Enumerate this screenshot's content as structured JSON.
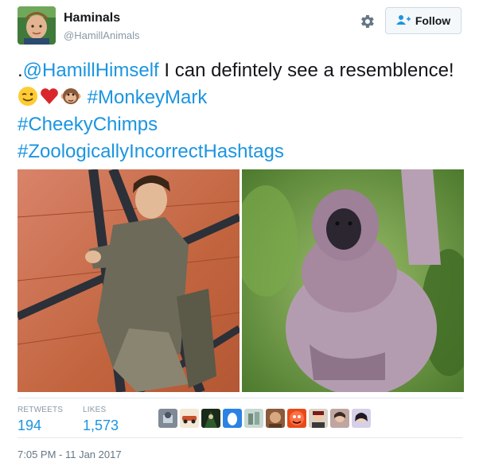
{
  "author": {
    "display_name": "Haminals",
    "handle": "@HamillAnimals"
  },
  "header": {
    "follow_label": "Follow",
    "settings_icon": "gear-icon",
    "follow_icon": "add-user-icon"
  },
  "tweet": {
    "prefix": ".",
    "mention": "@HamillHimself",
    "text_main": " I can defintely see a resemblence! ",
    "emojis": [
      "winking-face-icon",
      "red-heart-icon",
      "monkey-face-icon"
    ],
    "hashtags": [
      "#MonkeyMark",
      "#CheekyChimps",
      "#ZoologicallyIncorrectHashtags"
    ]
  },
  "stats": {
    "retweets_label": "RETWEETS",
    "retweets_value": "194",
    "likes_label": "LIKES",
    "likes_value": "1,573"
  },
  "likers": [
    "liker-avatar-1",
    "liker-avatar-2",
    "liker-avatar-3",
    "liker-avatar-4",
    "liker-avatar-5",
    "liker-avatar-6",
    "liker-avatar-7",
    "liker-avatar-8",
    "liker-avatar-9",
    "liker-avatar-10"
  ],
  "timestamp": "7:05 PM - 11 Jan 2017",
  "colors": {
    "link": "#1b95e0",
    "text": "#14171a",
    "muted": "#8899a6"
  }
}
